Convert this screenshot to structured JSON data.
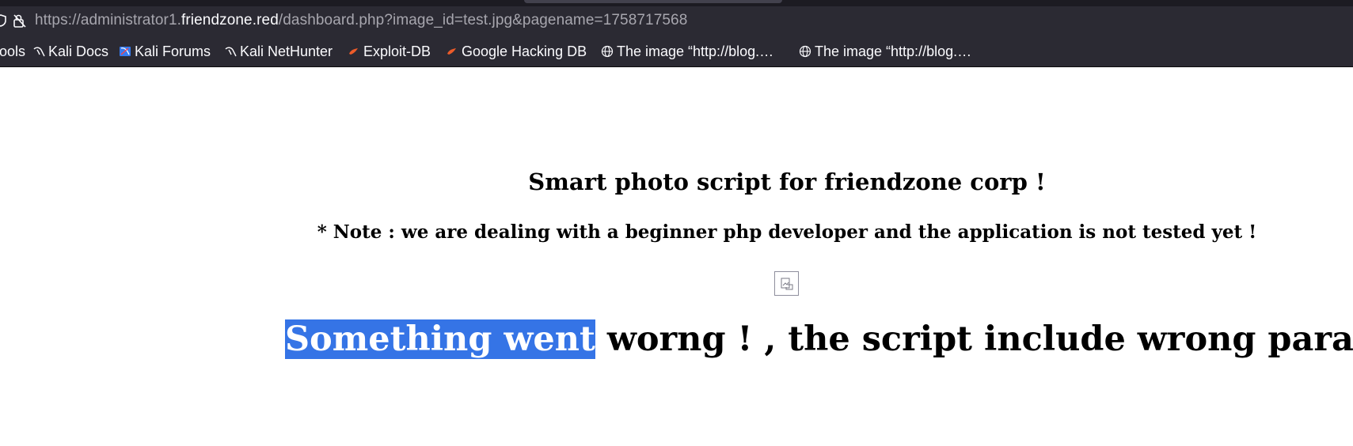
{
  "browser": {
    "url": {
      "prefix": "https://administrator1.",
      "host": "friendzone.red",
      "path": "/dashboard.php?image_id=test.jpg&pagename=1758717568"
    },
    "bookmarks": [
      {
        "label": "ools",
        "icon": "none"
      },
      {
        "label": "Kali Docs",
        "icon": "kali-dragon-icon"
      },
      {
        "label": "Kali Forums",
        "icon": "kali-forums-icon"
      },
      {
        "label": "Kali NetHunter",
        "icon": "kali-dragon-icon"
      },
      {
        "label": "Exploit-DB",
        "icon": "exploit-db-icon"
      },
      {
        "label": "Google Hacking DB",
        "icon": "exploit-db-icon"
      },
      {
        "label": "The image “http://blog.…",
        "icon": "globe-icon"
      },
      {
        "label": "The image “http://blog.…",
        "icon": "globe-icon"
      }
    ]
  },
  "page": {
    "title": "Smart photo script for friendzone corp !",
    "note": "* Note : we are dealing with a beginner php developer and the application is not tested yet !",
    "image_alt": "broken-image-icon",
    "error_selected": "Something went",
    "error_rest": " worng ! , the script include wrong param !"
  },
  "colors": {
    "chrome_bg": "#2b2a33",
    "selection": "#3574e6"
  }
}
